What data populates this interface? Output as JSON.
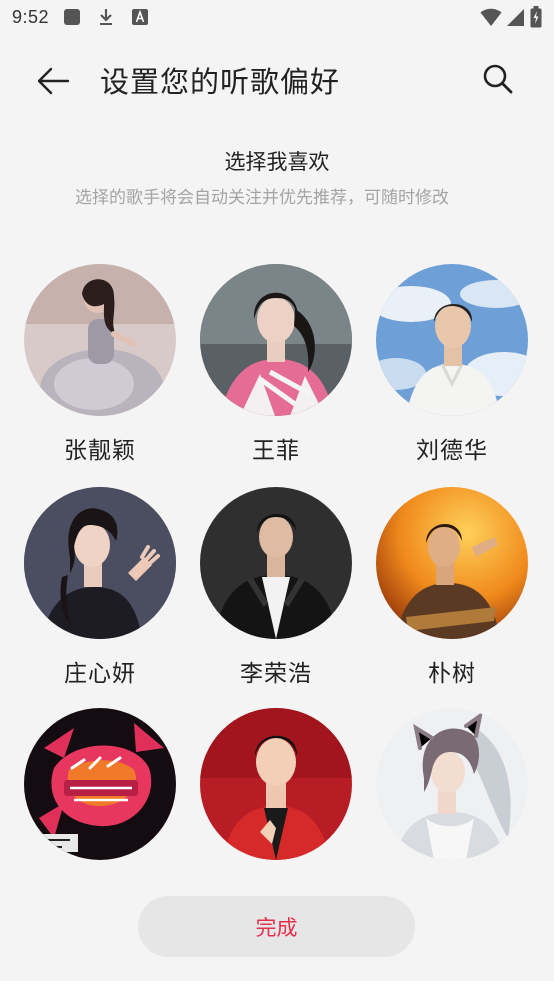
{
  "status_bar": {
    "time": "9:52"
  },
  "header": {
    "title": "设置您的听歌偏好"
  },
  "section": {
    "title": "选择我喜欢",
    "subtitle": "选择的歌手将会自动关注并优先推荐，可随时修改"
  },
  "artists": [
    {
      "name": "张靓颖"
    },
    {
      "name": "王菲"
    },
    {
      "name": "刘德华"
    },
    {
      "name": "庄心妍"
    },
    {
      "name": "李荣浩"
    },
    {
      "name": "朴树"
    },
    {
      "name": ""
    },
    {
      "name": ""
    },
    {
      "name": ""
    }
  ],
  "footer": {
    "done_label": "完成"
  },
  "colors": {
    "accent": "#e4304c",
    "background": "#f4f4f4"
  }
}
